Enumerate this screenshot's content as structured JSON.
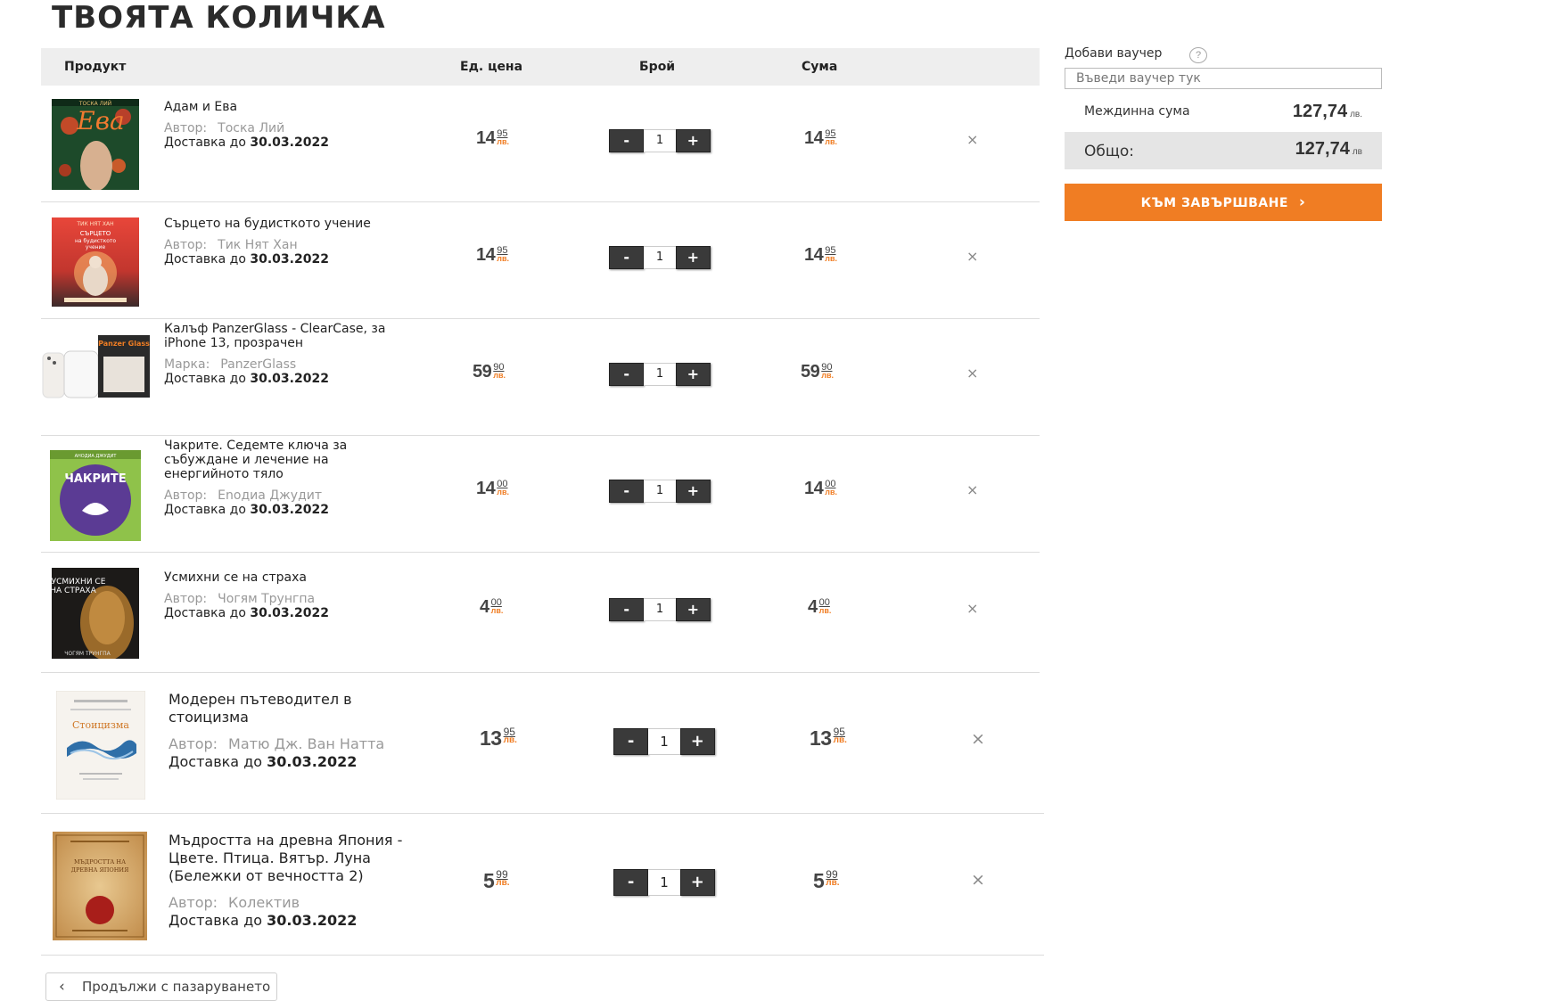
{
  "page": {
    "title": "ТВОЯТА КОЛИЧКА"
  },
  "table": {
    "headers": {
      "product": "Продукт",
      "unit_price": "Ед. цена",
      "quantity": "Брой",
      "total": "Сума"
    }
  },
  "qty_controls": {
    "minus": "-",
    "plus": "+"
  },
  "remove_symbol": "×",
  "currency": "лв.",
  "items": [
    {
      "name": "Адам и Ева",
      "meta_label": "Автор:",
      "meta_value": "Тоска Лий",
      "delivery_label": "Доставка до",
      "delivery_date": "30.03.2022",
      "unit_price_int": "14",
      "unit_price_frac": "95",
      "qty": "1",
      "total_int": "14",
      "total_frac": "95",
      "cover_text": "Ева",
      "cover_top": "ТОСКА ЛИЙ"
    },
    {
      "name": "Сърцето на будисткото учение",
      "meta_label": "Автор:",
      "meta_value": "Тик Нят Хан",
      "delivery_label": "Доставка до",
      "delivery_date": "30.03.2022",
      "unit_price_int": "14",
      "unit_price_frac": "95",
      "qty": "1",
      "total_int": "14",
      "total_frac": "95",
      "cover_text": "СЪРЦЕТО на будисткото учение",
      "cover_top": "ТИК НЯТ ХАН"
    },
    {
      "name": "Калъф PanzerGlass - ClearCase, за iPhone 13, прозрачен",
      "meta_label": "Марка:",
      "meta_value": "PanzerGlass",
      "delivery_label": "Доставка до",
      "delivery_date": "30.03.2022",
      "unit_price_int": "59",
      "unit_price_frac": "90",
      "qty": "1",
      "total_int": "59",
      "total_frac": "90",
      "cover_text": "Panzer Glass"
    },
    {
      "name": "Чакрите. Седемте ключа за събуждане и лечение на енергийното тяло",
      "meta_label": "Автор:",
      "meta_value": "Еnодиа Джудит",
      "delivery_label": "Доставка до",
      "delivery_date": "30.03.2022",
      "unit_price_int": "14",
      "unit_price_frac": "00",
      "qty": "1",
      "total_int": "14",
      "total_frac": "00",
      "cover_text": "ЧАКРИТЕ",
      "cover_top": "АНОДИА ДЖУДИТ"
    },
    {
      "name": "Усмихни се на страха",
      "meta_label": "Автор:",
      "meta_value": "Чогям Трунгпа",
      "delivery_label": "Доставка до",
      "delivery_date": "30.03.2022",
      "unit_price_int": "4",
      "unit_price_frac": "00",
      "qty": "1",
      "total_int": "4",
      "total_frac": "00",
      "cover_text": "УСМИХНИ СЕ НА СТРАХА",
      "cover_bottom": "ЧОГЯМ ТРУНГПА"
    },
    {
      "name": "Модерен пътеводител в стоицизма",
      "meta_label": "Автор:",
      "meta_value": "Матю Дж. Ван Натта",
      "delivery_label": "Доставка до",
      "delivery_date": "30.03.2022",
      "unit_price_int": "13",
      "unit_price_frac": "95",
      "qty": "1",
      "total_int": "13",
      "total_frac": "95",
      "cover_text": "Стоицизма"
    },
    {
      "name": "Мъдростта на древна Япония - Цвете. Птица. Вятър. Луна (Бележки от вечността 2)",
      "meta_label": "Автор:",
      "meta_value": "Колектив",
      "delivery_label": "Доставка до",
      "delivery_date": "30.03.2022",
      "unit_price_int": "5",
      "unit_price_frac": "99",
      "qty": "1",
      "total_int": "5",
      "total_frac": "99",
      "cover_text": "МЪДРОСТТА НА ДРЕВНА ЯПОНИЯ"
    }
  ],
  "continue_shopping": {
    "label": "Продължи с пазаруването"
  },
  "sidebar": {
    "voucher_label": "Добави ваучер",
    "help_symbol": "?",
    "voucher_placeholder": "Въведи ваучер тук",
    "subtotal_label": "Междинна сума",
    "subtotal_value": "127,74",
    "subtotal_currency": "лв.",
    "total_label": "Общо:",
    "total_value": "127,74",
    "total_currency": "лв",
    "checkout_label": "КЪМ ЗАВЪРШВАНЕ",
    "checkout_arrow": "›"
  },
  "colors": {
    "accent": "#f07d23",
    "header_bg": "#eeeeee",
    "button_dark": "#3a3a3a"
  }
}
